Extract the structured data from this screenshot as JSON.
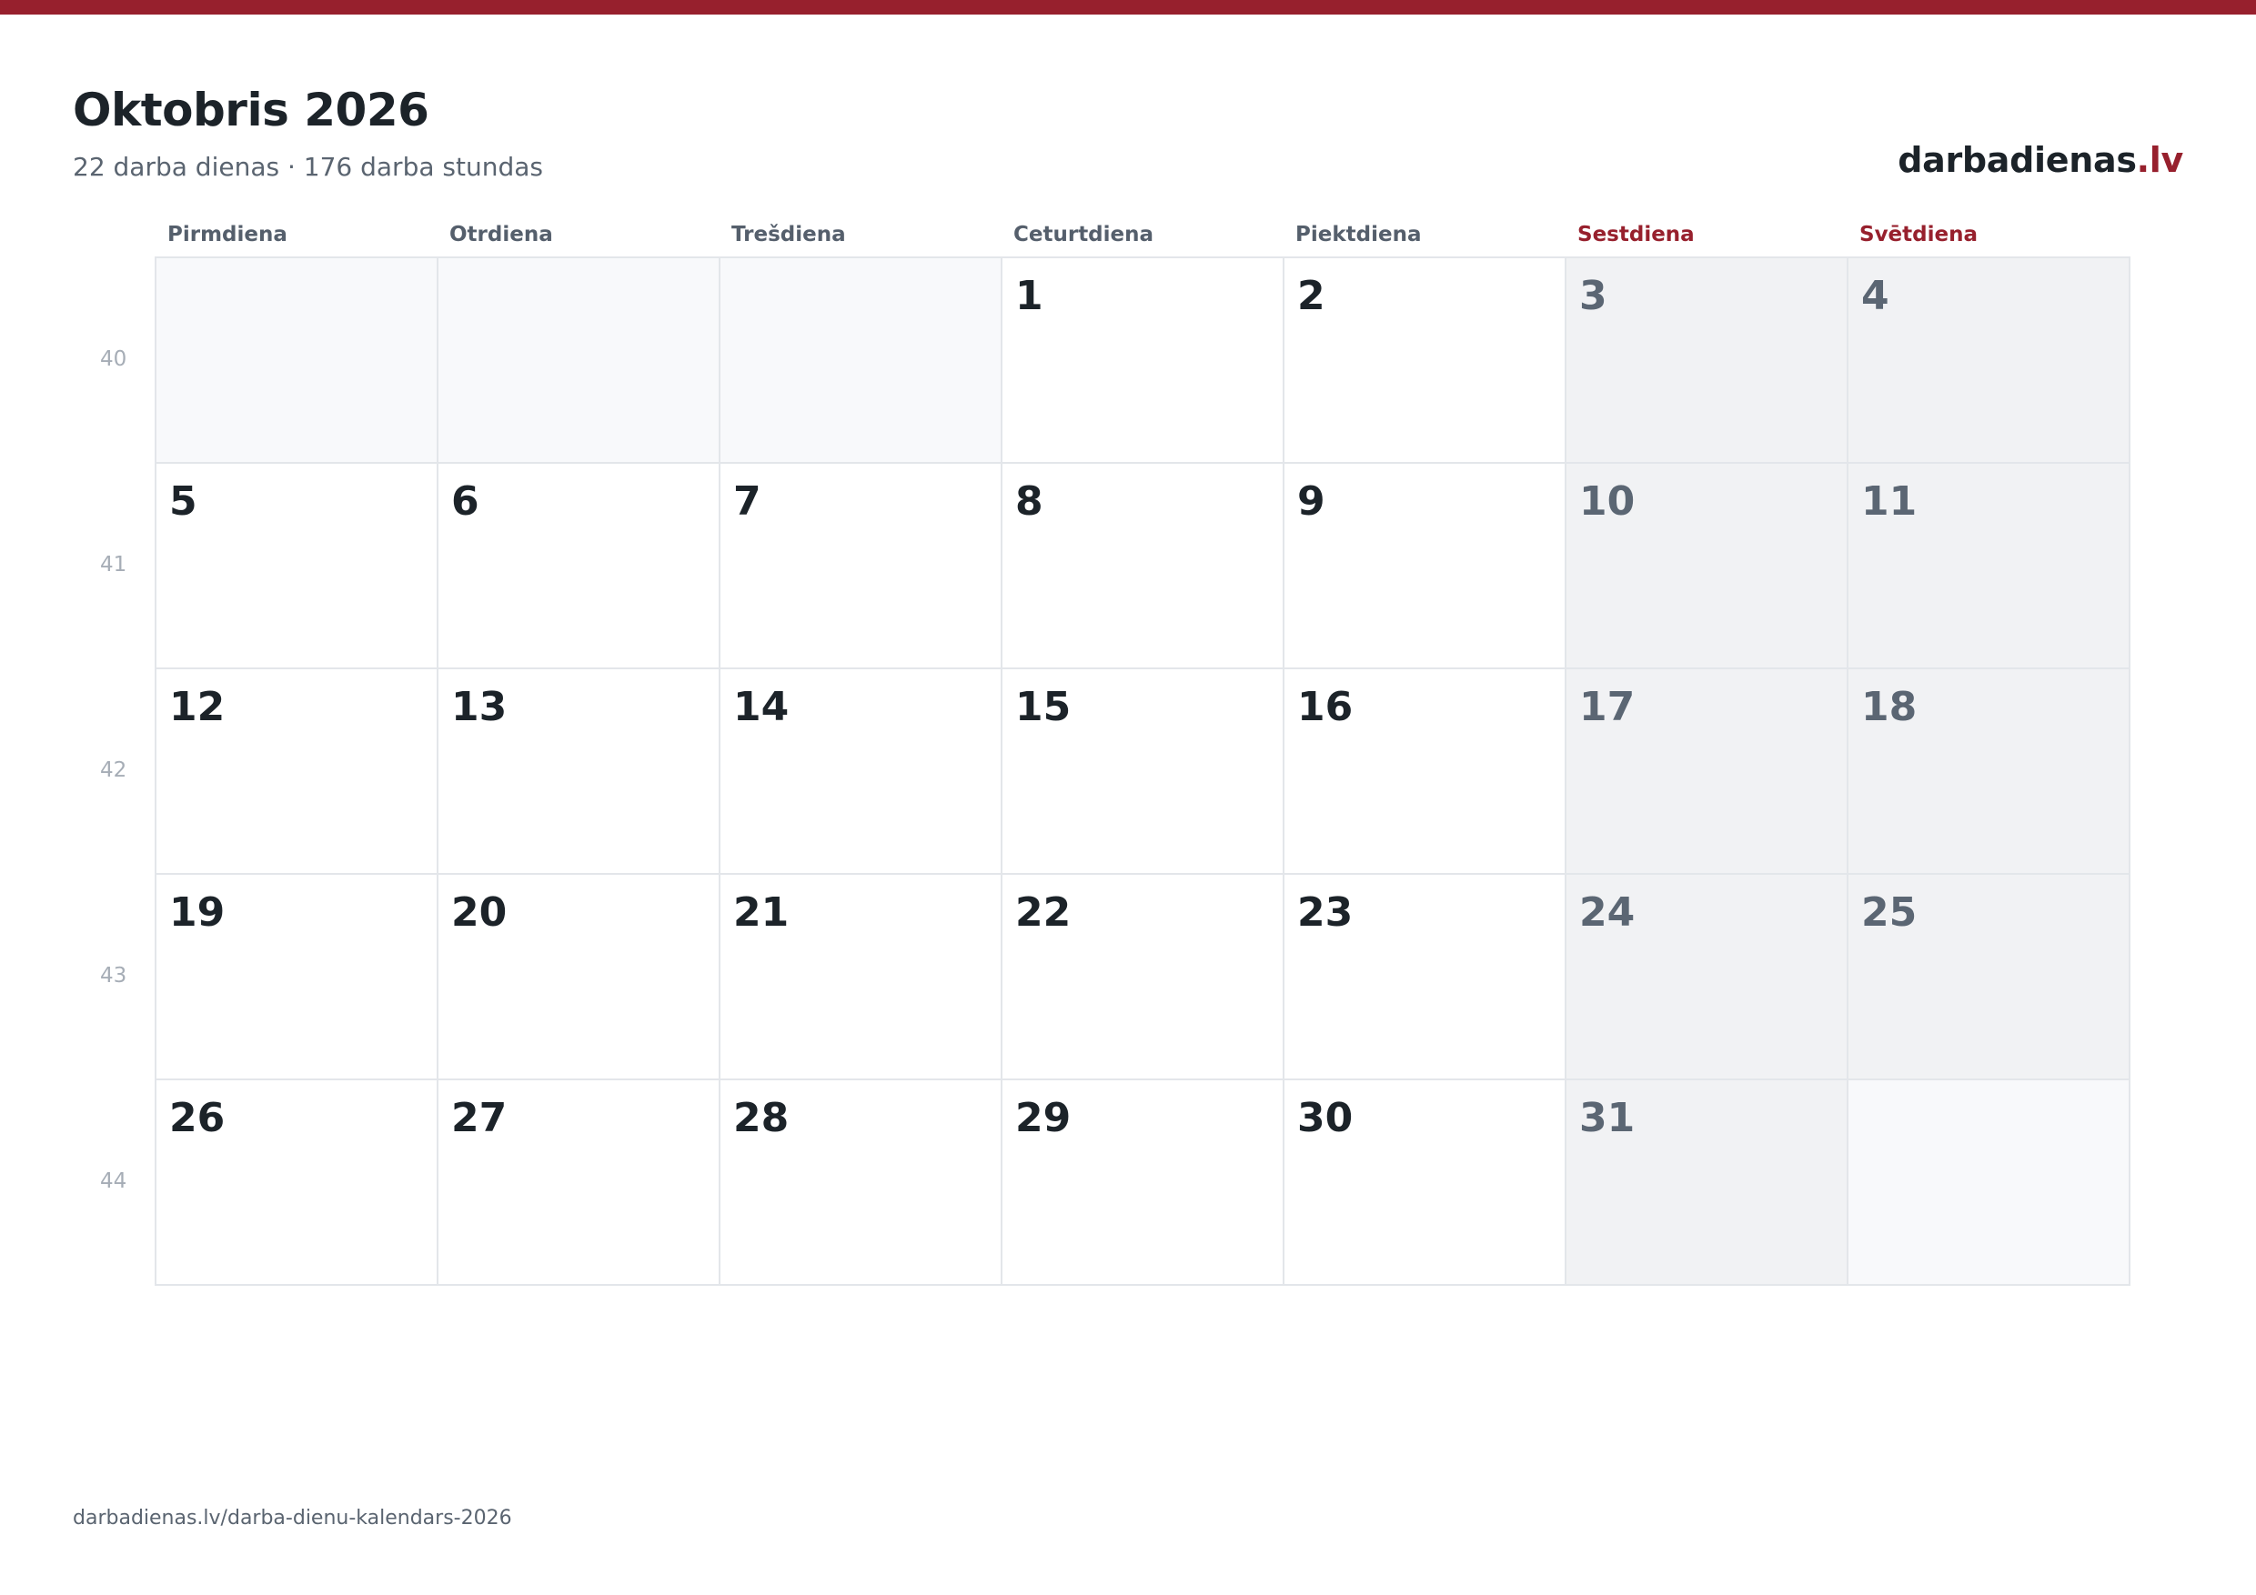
{
  "header": {
    "title": "Oktobris 2026",
    "subtitle": "22 darba dienas · 176 darba stundas",
    "brand_name": "darbadienas",
    "brand_tld": ".lv"
  },
  "weekdays": [
    "Pirmdiena",
    "Otrdiena",
    "Trešdiena",
    "Ceturtdiena",
    "Piektdiena",
    "Sestdiena",
    "Svētdiena"
  ],
  "weeks": [
    {
      "number": "40",
      "days": [
        "",
        "",
        "",
        "1",
        "2",
        "3",
        "4"
      ]
    },
    {
      "number": "41",
      "days": [
        "5",
        "6",
        "7",
        "8",
        "9",
        "10",
        "11"
      ]
    },
    {
      "number": "42",
      "days": [
        "12",
        "13",
        "14",
        "15",
        "16",
        "17",
        "18"
      ]
    },
    {
      "number": "43",
      "days": [
        "19",
        "20",
        "21",
        "22",
        "23",
        "24",
        "25"
      ]
    },
    {
      "number": "44",
      "days": [
        "26",
        "27",
        "28",
        "29",
        "30",
        "31",
        ""
      ]
    }
  ],
  "footer": {
    "url": "darbadienas.lv/darba-dienu-kalendars-2026"
  },
  "colors": {
    "accent": "#97202d",
    "weekend_bg": "#f1f2f4",
    "empty_bg": "#f8f9fb",
    "grid_line": "#e3e6ea"
  }
}
